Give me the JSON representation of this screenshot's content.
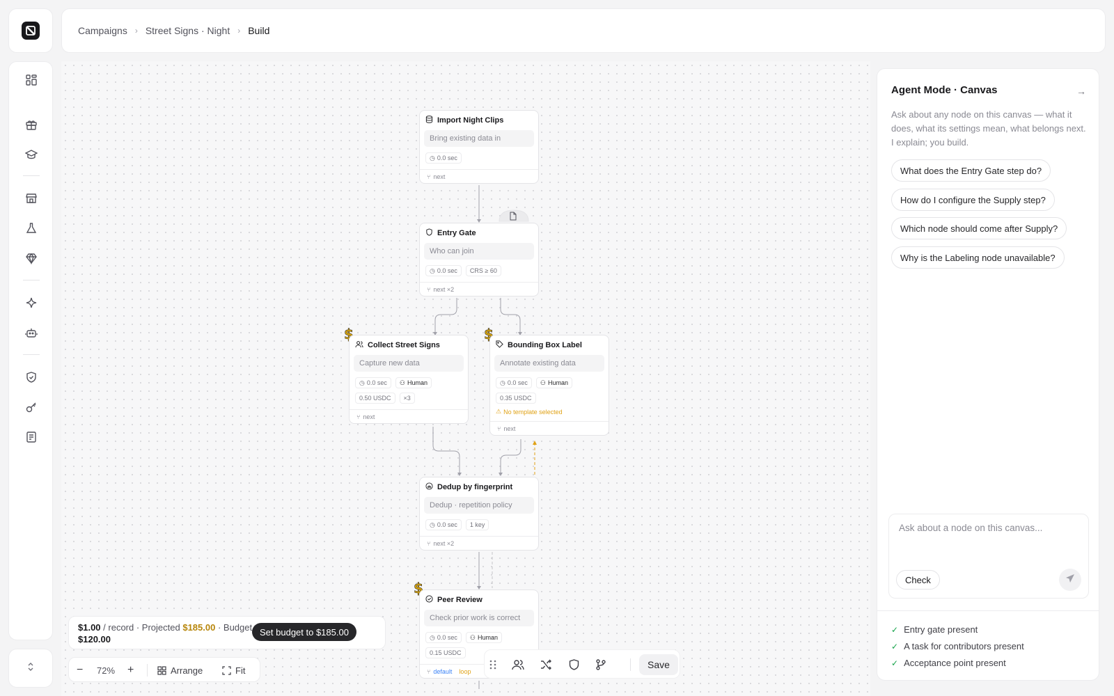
{
  "breadcrumb": {
    "items": [
      "Campaigns",
      "Street Signs · Night"
    ],
    "current": "Build"
  },
  "sidebar": {
    "icons": [
      "dashboard-icon",
      "gift-icon",
      "graduation-cap-icon",
      "store-icon",
      "flask-icon",
      "gem-icon",
      "sparkle-icon",
      "bot-icon",
      "shield-check-icon",
      "key-icon",
      "report-icon"
    ]
  },
  "nodes": {
    "import": {
      "title": "Import Night Clips",
      "desc": "Bring existing data in",
      "time": "0.0 sec",
      "next": "next"
    },
    "entry": {
      "title": "Entry Gate",
      "desc": "Who can join",
      "time": "0.0 sec",
      "crs": "CRS ≥ 60",
      "next": "next ×2"
    },
    "collect": {
      "title": "Collect Street Signs",
      "desc": "Capture new data",
      "time": "0.0 sec",
      "role": "Human",
      "price": "0.50 USDC",
      "mult": "×3",
      "next": "next"
    },
    "bbox": {
      "title": "Bounding Box Label",
      "desc": "Annotate existing data",
      "time": "0.0 sec",
      "role": "Human",
      "price": "0.35 USDC",
      "warning": "No template selected",
      "next": "next"
    },
    "dedup": {
      "title": "Dedup by fingerprint",
      "desc": "Dedup · repetition policy",
      "time": "0.0 sec",
      "key": "1 key",
      "next": "next ×2"
    },
    "review": {
      "title": "Peer Review",
      "desc": "Check prior work is correct",
      "time": "0.0 sec",
      "role": "Human",
      "price": "0.15 USDC",
      "default": "default",
      "loop": "loop"
    }
  },
  "cost_marker": "$",
  "agent": {
    "title": "Agent Mode · Canvas",
    "description": "Ask about any node on this canvas — what it does, what its settings mean, what belongs next. I explain; you build.",
    "suggestions": [
      "What does the Entry Gate step do?",
      "How do I configure the Supply step?",
      "Which node should come after Supply?",
      "Why is the Labeling node unavailable?"
    ],
    "input_placeholder": "Ask about a node on this canvas...",
    "check_label": "Check",
    "checklist": [
      "Entry gate present",
      "A task for contributors present",
      "Acceptance point present"
    ]
  },
  "budget": {
    "price": "$1.00",
    "per": "/ record · Projected",
    "projected": "$185.00",
    "budget_label": "· Budget",
    "budget_value": "$120.00",
    "button": "Set budget to $185.00"
  },
  "zoom": {
    "level": "72%",
    "arrange": "Arrange",
    "fit": "Fit"
  },
  "toolbar": {
    "save": "Save"
  },
  "colors": {
    "accent_dark": "#27272a",
    "cost_gold": "#d4a10e",
    "warning": "#e0a216",
    "success": "#16a34a",
    "link_blue": "#3b82f6"
  }
}
